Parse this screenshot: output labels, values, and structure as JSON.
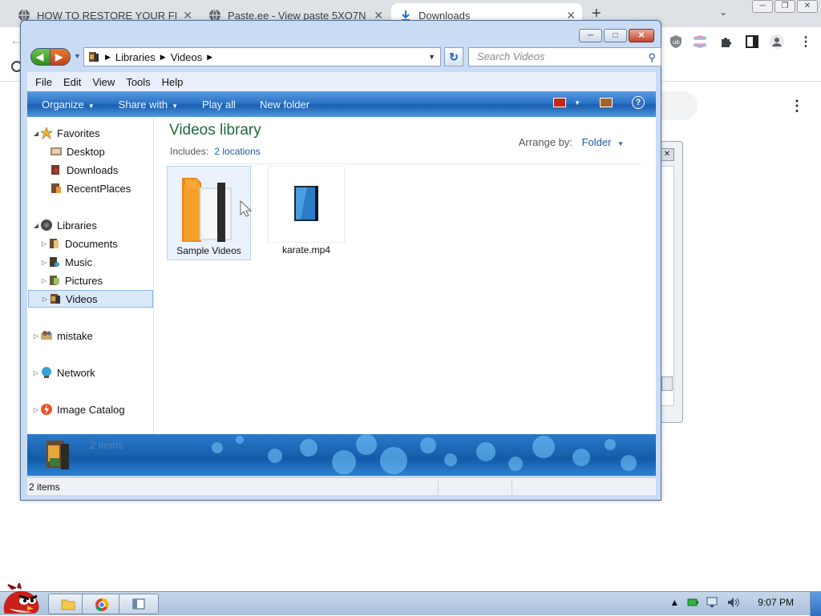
{
  "browser": {
    "tabs": [
      {
        "label": "HOW TO RESTORE YOUR FILES"
      },
      {
        "label": "Paste.ee - View paste 5XO7N"
      },
      {
        "label": "Downloads"
      }
    ],
    "new_tab": "+",
    "tab_close": "✕"
  },
  "explorer": {
    "address": {
      "crumbs": [
        "Libraries",
        "Videos"
      ]
    },
    "search_placeholder": "Search Videos",
    "menu": [
      "File",
      "Edit",
      "View",
      "Tools",
      "Help"
    ],
    "commands": {
      "organize": "Organize",
      "share_with": "Share with",
      "play_all": "Play all",
      "new_folder": "New folder"
    },
    "nav": {
      "favorites": "Favorites",
      "desktop": "Desktop",
      "downloads": "Downloads",
      "recent": "RecentPlaces",
      "libraries": "Libraries",
      "documents": "Documents",
      "music": "Music",
      "pictures": "Pictures",
      "videos": "Videos",
      "mistake": "mistake",
      "network": "Network",
      "image_catalog": "Image Catalog"
    },
    "library": {
      "title": "Videos library",
      "includes_label": "Includes:",
      "includes_link": "2 locations",
      "arrange_label": "Arrange by:",
      "arrange_value": "Folder"
    },
    "items": [
      {
        "label": "Sample Videos"
      },
      {
        "label": "karate.mp4"
      }
    ],
    "details_count": "2 items",
    "status_text": "2 items"
  },
  "taskbar": {
    "clock": "9:07 PM"
  },
  "colors": {
    "command_bar": "#2b74c7",
    "library_title": "#1f6b3a",
    "link": "#1e5bb0",
    "taskbar": "#b8cce3"
  }
}
